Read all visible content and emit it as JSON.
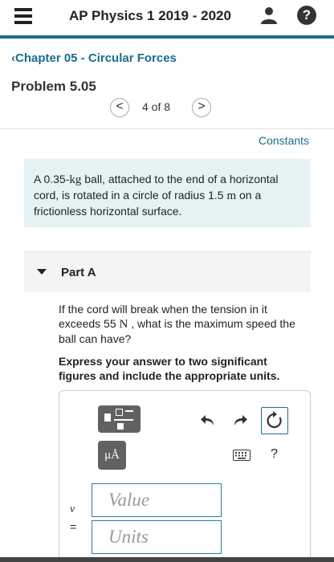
{
  "header": {
    "title": "AP Physics 1 2019 - 2020",
    "menu_icon": "hamburger-icon",
    "user_icon": "user-icon",
    "help_icon": "help-icon",
    "help_symbol": "?",
    "accent_color": "#1b6d8c"
  },
  "nav": {
    "chapter_link": "Chapter 05 - Circular Forces",
    "problem_title": "Problem 5.05",
    "prev_symbol": "<",
    "next_symbol": ">",
    "position": "4 of 8"
  },
  "constants_link": "Constants",
  "problem": {
    "text_1": "A 0.35-",
    "unit_kg": "kg",
    "text_2": " ball, attached to the end of a horizontal cord, is rotated in a circle of radius 1.5 ",
    "unit_m": "m",
    "text_3": " on a frictionless horizontal surface."
  },
  "part": {
    "label": "Part A",
    "question_1": "If the cord will break when the tension in it exceeds 55 ",
    "unit_n": "N",
    "question_2": " , what is the maximum speed the ball can have?",
    "instructions": "Express your answer to two significant figures and include the appropriate units."
  },
  "answer": {
    "units_tool_label": "μÅ",
    "help_label": "?",
    "variable": "v",
    "equals": "=",
    "value_placeholder": "Value",
    "units_placeholder": "Units"
  }
}
